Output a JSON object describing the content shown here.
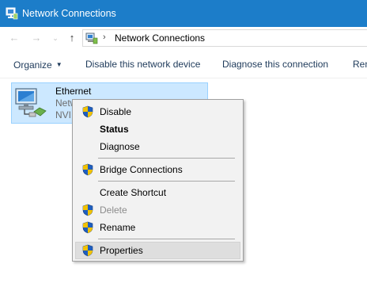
{
  "window": {
    "title": "Network Connections"
  },
  "address_bar": {
    "separator": "›",
    "location": "Network Connections"
  },
  "toolbar": {
    "organize": "Organize",
    "disable_device": "Disable this network device",
    "diagnose": "Diagnose this connection",
    "rename_partial": "Ren"
  },
  "connection": {
    "name": "Ethernet",
    "status_partial": "Netw",
    "device_partial": "NVID"
  },
  "context_menu": {
    "disable": "Disable",
    "status": "Status",
    "diagnose": "Diagnose",
    "bridge": "Bridge Connections",
    "shortcut": "Create Shortcut",
    "delete": "Delete",
    "rename": "Rename",
    "properties": "Properties"
  },
  "colors": {
    "titlebar": "#1c7dc9",
    "selection": "#cce8ff",
    "menu_bg": "#f2f2f2",
    "shield_blue": "#1f5fbf",
    "shield_yellow": "#f2c200"
  },
  "icons": [
    "network-connections-icon",
    "back-arrow-icon",
    "forward-arrow-icon",
    "recent-dropdown-icon",
    "up-arrow-icon",
    "chevron-down-icon",
    "ethernet-adapter-icon",
    "uac-shield-icon"
  ]
}
